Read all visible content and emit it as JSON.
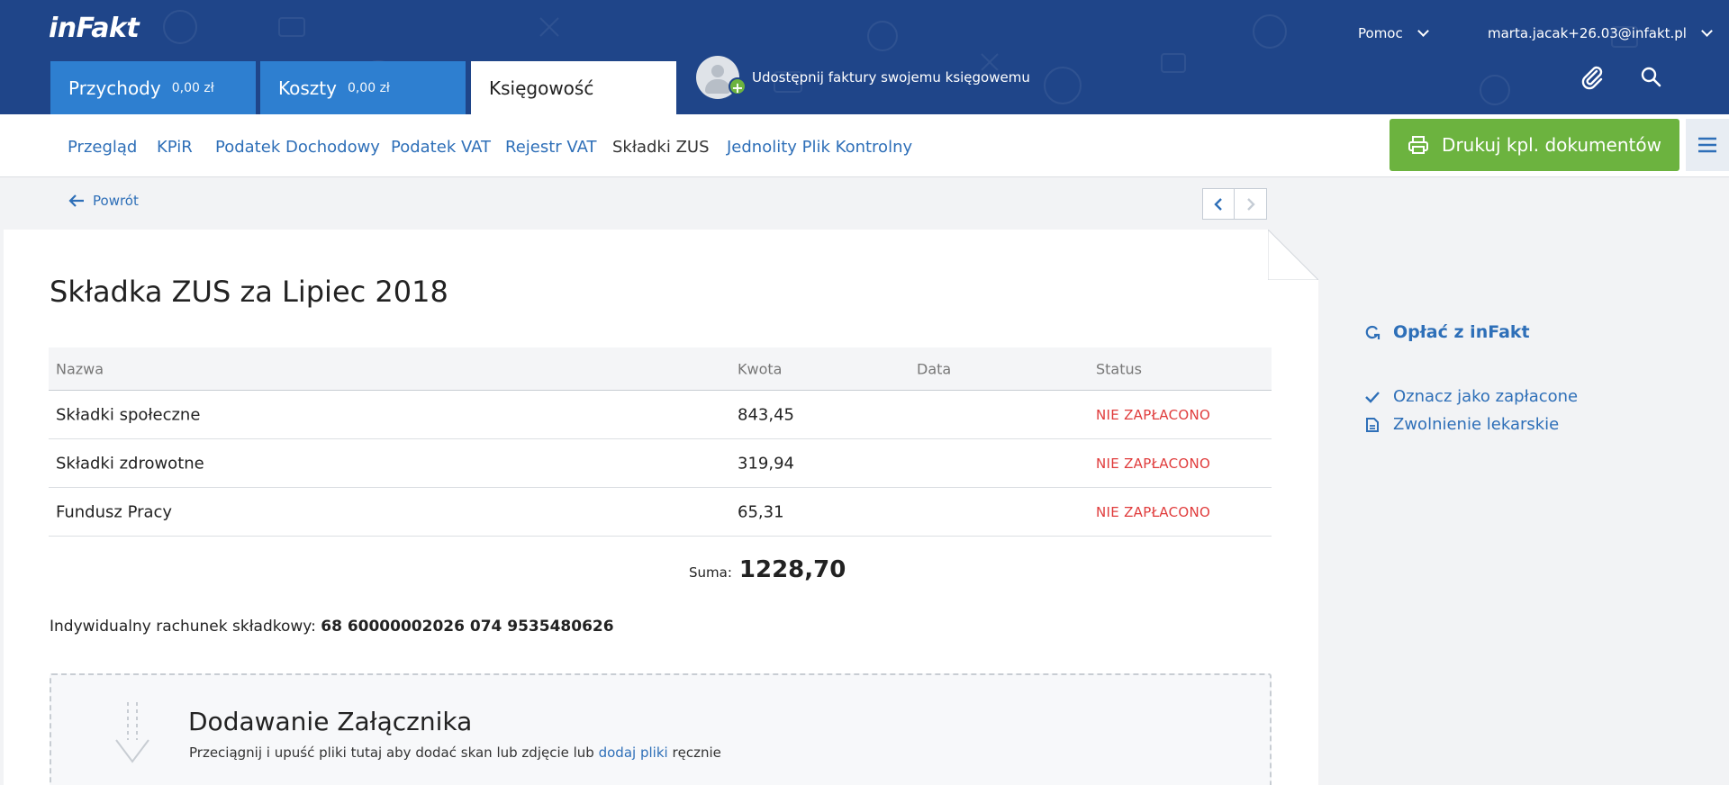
{
  "header": {
    "logo": "inFakt",
    "help_label": "Pomoc",
    "user_email": "marta.jacak+26.03@infakt.pl",
    "main_tabs": [
      {
        "label": "Przychody",
        "amount": "0,00 zł"
      },
      {
        "label": "Koszty",
        "amount": "0,00 zł"
      },
      {
        "label": "Księgowość"
      }
    ],
    "share_text": "Udostępnij faktury swojemu księgowemu",
    "icons": [
      "paperclip-icon",
      "search-icon"
    ]
  },
  "subnav": {
    "items": [
      "Przegląd",
      "KPiR",
      "Podatek Dochodowy",
      "Podatek VAT",
      "Rejestr VAT",
      "Składki ZUS",
      "Jednolity Plik Kontrolny"
    ],
    "active": "Składki ZUS",
    "print_button": "Drukuj kpl. dokumentów"
  },
  "back_label": "Powrót",
  "document": {
    "title": "Składka ZUS za Lipiec 2018",
    "table": {
      "headers": [
        "Nazwa",
        "Kwota",
        "Data",
        "Status"
      ],
      "rows": [
        {
          "name": "Składki społeczne",
          "amount": "843,45",
          "date": "",
          "status": "NIE ZAPŁACONO"
        },
        {
          "name": "Składki zdrowotne",
          "amount": "319,94",
          "date": "",
          "status": "NIE ZAPŁACONO"
        },
        {
          "name": "Fundusz Pracy",
          "amount": "65,31",
          "date": "",
          "status": "NIE ZAPŁACONO"
        }
      ]
    },
    "sum_label": "Suma:",
    "sum_value": "1228,70",
    "account_label": "Indywidualny rachunek składkowy:",
    "account_number": "68 60000002026 074 9535480626",
    "attachment": {
      "title": "Dodawanie Załącznika",
      "text_before": "Przeciągnij i upuść pliki tutaj aby dodać skan lub zdjęcie lub",
      "link": "dodaj pliki",
      "text_after": "ręcznie"
    }
  },
  "side_actions": {
    "pay": "Opłać z inFakt",
    "mark_paid": "Oznacz jako zapłacone",
    "sick_leave": "Zwolnienie lekarskie"
  },
  "colors": {
    "header_bg": "#1f4589",
    "tab_blue": "#2e7fd0",
    "link_blue": "#2e6fb8",
    "print_green": "#6cb33f",
    "status_red": "#e03c3c"
  }
}
